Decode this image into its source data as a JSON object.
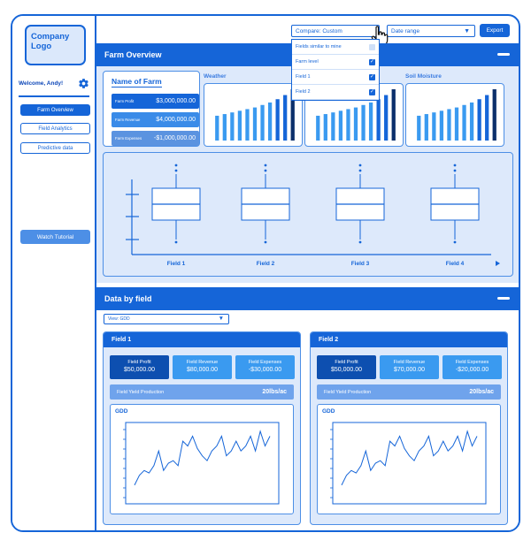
{
  "sidebar": {
    "logo": "Company Logo",
    "welcome": "Welcome, Andy!",
    "nav": [
      "Farm Overview",
      "Field Analytics",
      "Predictive data"
    ],
    "tutorial": "Watch Tutorial"
  },
  "topbar": {
    "compare": "Compare: Custom",
    "date_range": "Date range",
    "export": "Export",
    "dropdown": [
      {
        "label": "Fields similar to mine",
        "checked": false
      },
      {
        "label": "Farm level",
        "checked": true
      },
      {
        "label": "Field 1",
        "checked": true
      },
      {
        "label": "Field 2",
        "checked": true
      }
    ]
  },
  "overview": {
    "title": "Farm Overview",
    "card_title": "Name of Farm",
    "metrics": [
      {
        "label": "Farm Profit",
        "value": "$3,000,000.00"
      },
      {
        "label": "Farm Revenue",
        "value": "$4,000,000.00"
      },
      {
        "label": "Farm Expenses",
        "value": "-$1,000,000.00"
      }
    ],
    "chart_titles": [
      "Weather",
      "",
      "Soil Moisture"
    ],
    "box_labels": [
      "Field 1",
      "Field 2",
      "Field 3",
      "Field 4"
    ]
  },
  "data_by_field": {
    "title": "Data by field",
    "view_select": "View: GDD",
    "fields": [
      {
        "name": "Field 1",
        "metrics": [
          {
            "label": "Field Profit",
            "value": "$50,000.00"
          },
          {
            "label": "Field Revenue",
            "value": "$80,000.00"
          },
          {
            "label": "Field Expenses",
            "value": "-$30,000.00"
          }
        ],
        "yield_label": "Field Yield Production",
        "yield_value": "20lbs/ac",
        "chart_label": "GDD"
      },
      {
        "name": "Field 2",
        "metrics": [
          {
            "label": "Field Profit",
            "value": "$50,000.00"
          },
          {
            "label": "Field Revenue",
            "value": "$70,000.00"
          },
          {
            "label": "Field Expenses",
            "value": "-$20,000.00"
          }
        ],
        "yield_label": "Field Yield Production",
        "yield_value": "20lbs/ac",
        "chart_label": "GDD"
      }
    ]
  },
  "colors": {
    "primary": "#1565d8",
    "light": "#dde9fb",
    "medium": "#4d8fe6",
    "dark_bar": "#0b2f6b"
  },
  "chart_data": [
    {
      "type": "bar",
      "title": "Weather",
      "values": [
        3,
        3.2,
        3.4,
        3.6,
        3.8,
        4,
        4.3,
        4.6,
        5,
        5.5,
        6.2
      ]
    },
    {
      "type": "bar",
      "title": "",
      "values": [
        3,
        3.2,
        3.4,
        3.6,
        3.8,
        4,
        4.3,
        4.6,
        5,
        5.5,
        6.2
      ]
    },
    {
      "type": "bar",
      "title": "Soil Moisture",
      "values": [
        3,
        3.2,
        3.4,
        3.6,
        3.8,
        4,
        4.3,
        4.6,
        5,
        5.5,
        6.2
      ]
    },
    {
      "type": "box",
      "categories": [
        "Field 1",
        "Field 2",
        "Field 3",
        "Field 4"
      ]
    },
    {
      "type": "line",
      "title": "GDD",
      "values": [
        2,
        4,
        5,
        4.5,
        6,
        9,
        5,
        6.5,
        7,
        6,
        11,
        10,
        12,
        9.5,
        8,
        7,
        9,
        10,
        12,
        8,
        9,
        11,
        9,
        10,
        12,
        9,
        13,
        10,
        12
      ]
    },
    {
      "type": "line",
      "title": "GDD",
      "values": [
        2,
        4,
        5,
        4.5,
        6,
        9,
        5,
        6.5,
        7,
        6,
        11,
        10,
        12,
        9.5,
        8,
        7,
        9,
        10,
        12,
        8,
        9,
        11,
        9,
        10,
        12,
        9,
        13,
        10,
        12
      ]
    }
  ]
}
